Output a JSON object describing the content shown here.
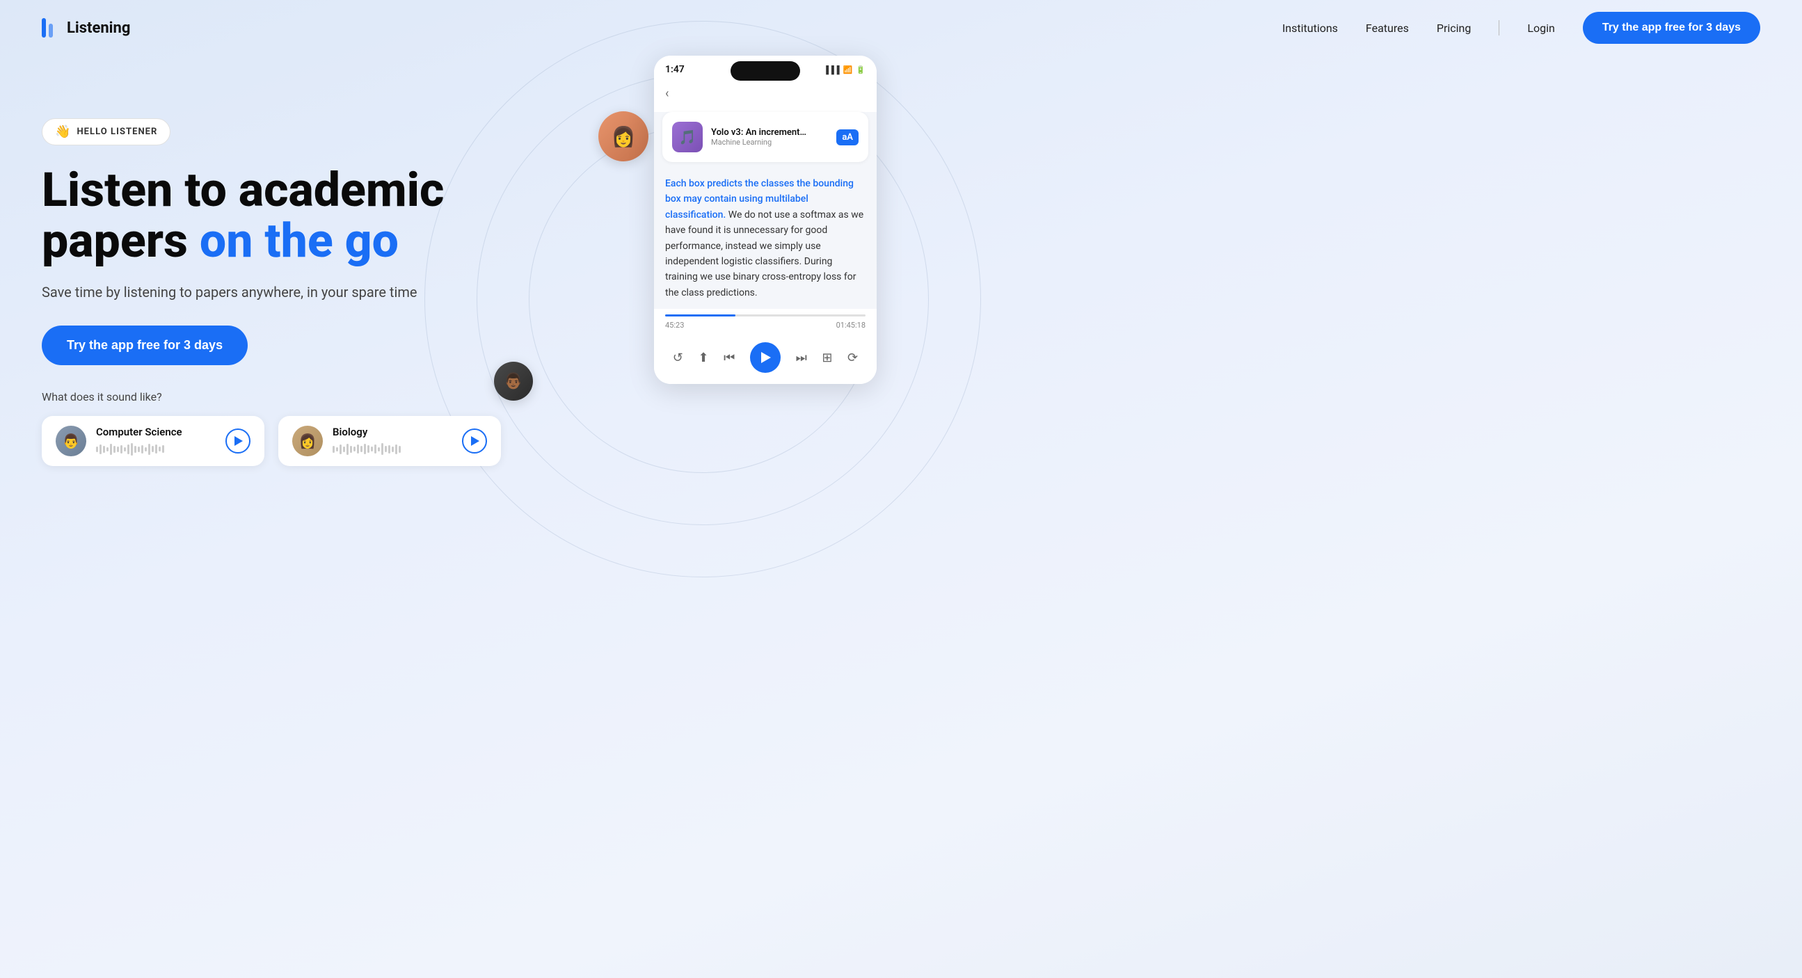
{
  "meta": {
    "title": "Listening - Listen to academic papers on the go"
  },
  "nav": {
    "logo_text": "Listening",
    "links": [
      {
        "label": "Institutions",
        "id": "institutions"
      },
      {
        "label": "Features",
        "id": "features"
      },
      {
        "label": "Pricing",
        "id": "pricing"
      },
      {
        "label": "Login",
        "id": "login"
      }
    ],
    "cta_label": "Try the app free for 3 days"
  },
  "hero": {
    "badge_emoji": "👋",
    "badge_text": "HELLO LISTENER",
    "title_line1": "Listen to academic",
    "title_line2_normal": "papers ",
    "title_line2_accent": "on the go",
    "subtitle": "Save time by listening to papers anywhere, in your spare time",
    "cta_label": "Try the app free for 3 days",
    "what_sounds": "What does it sound like?"
  },
  "audio_cards": [
    {
      "label": "Computer Science",
      "avatar_emoji": "👨",
      "avatar_style": "cs"
    },
    {
      "label": "Biology",
      "avatar_emoji": "👩",
      "avatar_style": "bio"
    }
  ],
  "phone": {
    "time": "1:47",
    "back": "‹",
    "paper_title": "Yolo v3: An incremental im...",
    "paper_category": "Machine Learning",
    "paper_icon_emoji": "🎵",
    "paper_aa": "aA",
    "text_highlight": "Each box predicts the classes the bounding box may contain using multilabel classification.",
    "text_body": " We do not use a softmax as we have found it is unnecessary for good performance, instead we simply use independent logistic classifiers. During training we use binary cross-entropy loss for the class predictions.",
    "progress_start": "45:23",
    "progress_end": "01:45:18",
    "progress_pct": 35
  },
  "floating_avatars": [
    {
      "id": "av1",
      "style": "orange"
    },
    {
      "id": "av2",
      "style": "blue"
    },
    {
      "id": "av3",
      "style": "dark"
    }
  ]
}
